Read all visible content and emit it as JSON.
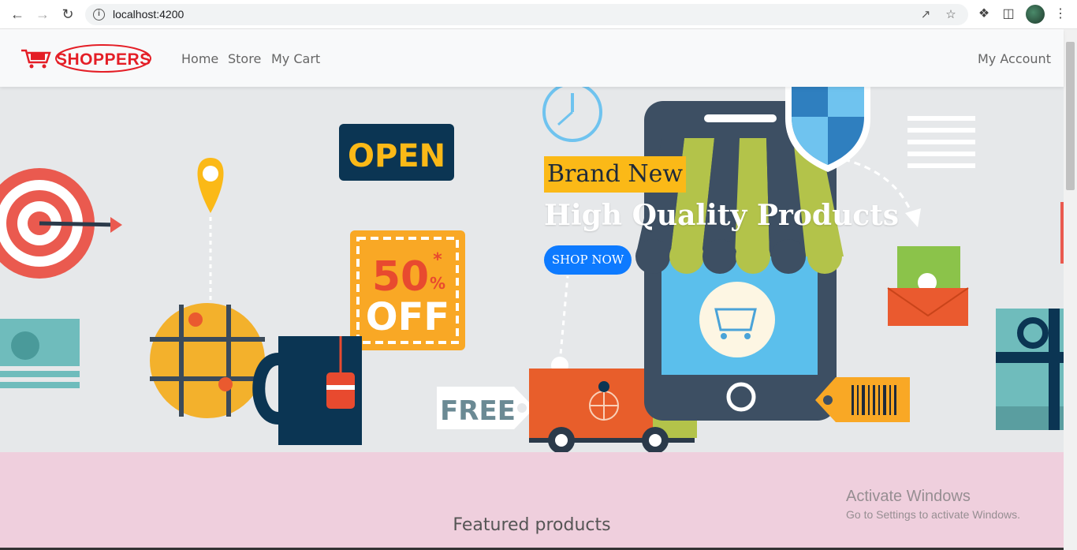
{
  "browser": {
    "url": "localhost:4200"
  },
  "navbar": {
    "brand": "SHOPPERS",
    "links": [
      "Home",
      "Store",
      "My Cart"
    ],
    "account": "My Account"
  },
  "hero": {
    "badge": "Brand New",
    "title": "High Quality Products",
    "cta": "SHOP NOW",
    "art_labels": {
      "open_sign": "OPEN",
      "discount_number": "50",
      "discount_percent": "%",
      "discount_star": "*",
      "discount_off": "OFF",
      "free_tag": "FREE"
    }
  },
  "featured": {
    "title": "Featured products"
  },
  "watermark": {
    "line1": "Activate Windows",
    "line2": "Go to Settings to activate Windows."
  },
  "colors": {
    "brand_red": "#e41e26",
    "hero_bg": "#e6e8ea",
    "badge_yellow": "#fbb917",
    "cta_blue": "#0d7aff",
    "featured_bg": "#efcfdd"
  }
}
